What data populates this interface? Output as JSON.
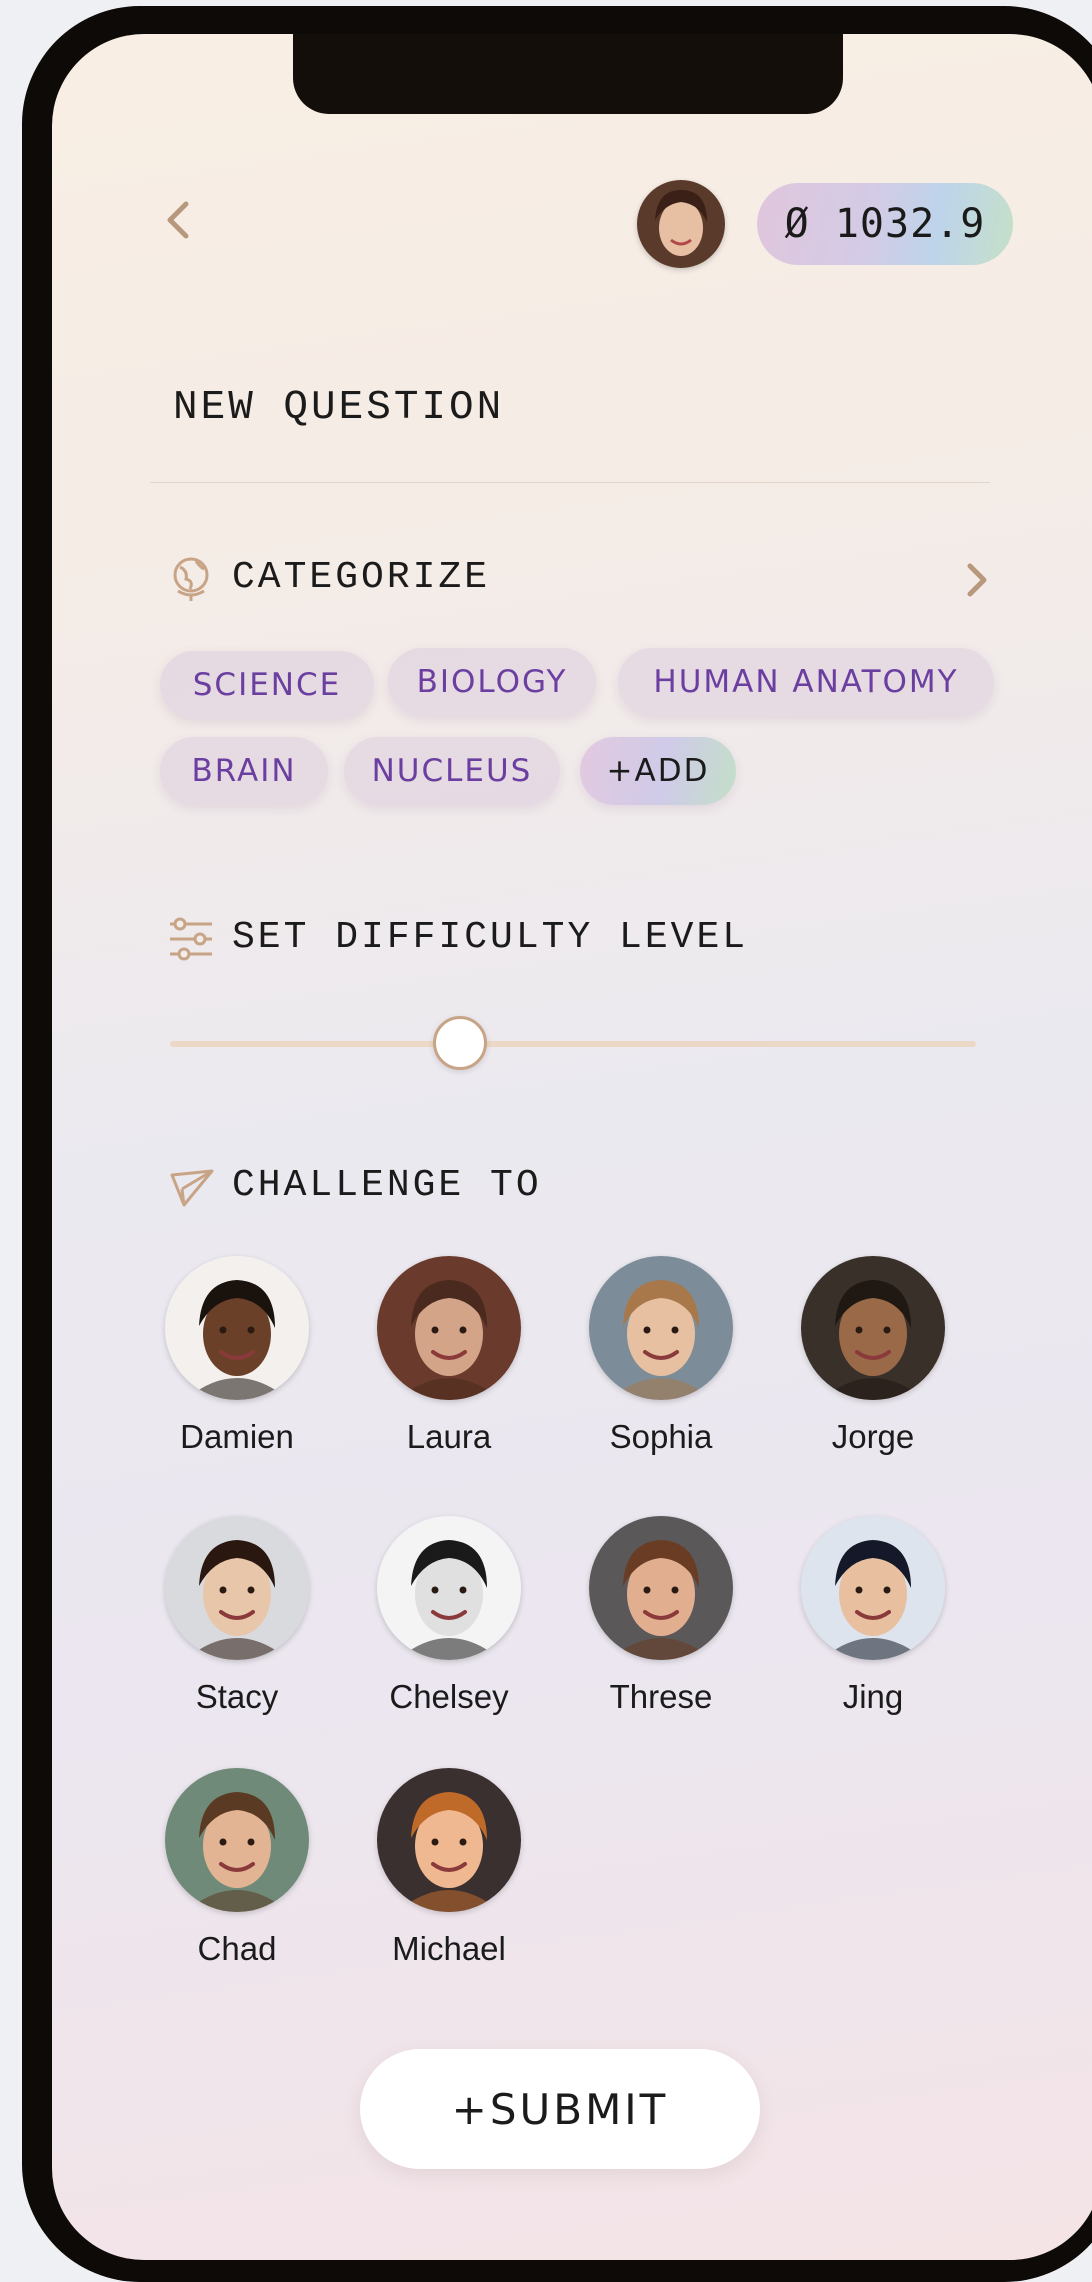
{
  "header": {
    "back_icon": "chevron-left-icon",
    "balance": "Ø 1032.9"
  },
  "page_title": "NEW QUESTION",
  "categorize": {
    "label": "CATEGORIZE",
    "icon": "globe-icon",
    "chips": [
      "SCIENCE",
      "BIOLOGY",
      "HUMAN ANATOMY",
      "BRAIN",
      "NUCLEUS"
    ],
    "add_label": "+ADD"
  },
  "difficulty": {
    "label": "SET DIFFICULTY LEVEL",
    "icon": "sliders-icon",
    "level": 0.36
  },
  "challenge": {
    "label": "CHALLENGE TO",
    "icon": "paper-plane-icon",
    "friends": [
      {
        "name": "Damien",
        "skin": "#6b4029",
        "hair": "#1a120c",
        "bg": "#f3f0ee"
      },
      {
        "name": "Laura",
        "skin": "#d4a488",
        "hair": "#4a2a1e",
        "bg": "#6a3a2c"
      },
      {
        "name": "Sophia",
        "skin": "#e6c0a0",
        "hair": "#a8784a",
        "bg": "#7c8c98"
      },
      {
        "name": "Jorge",
        "skin": "#9a6a48",
        "hair": "#201812",
        "bg": "#3a302a"
      },
      {
        "name": "Stacy",
        "skin": "#e8c6aa",
        "hair": "#2a1810",
        "bg": "#d8dade"
      },
      {
        "name": "Chelsey",
        "skin": "#e0e0e0",
        "hair": "#1a1a1a",
        "bg": "#f4f4f4"
      },
      {
        "name": "Threse",
        "skin": "#e2ae90",
        "hair": "#6a3c24",
        "bg": "#5a5858"
      },
      {
        "name": "Jing",
        "skin": "#e8c0a0",
        "hair": "#141828",
        "bg": "#dde4ee"
      },
      {
        "name": "Chad",
        "skin": "#e2b494",
        "hair": "#5a3a22",
        "bg": "#6f8a78"
      },
      {
        "name": "Michael",
        "skin": "#f0b890",
        "hair": "#c06a2a",
        "bg": "#3a3030"
      }
    ]
  },
  "submit_label": "+SUBMIT"
}
